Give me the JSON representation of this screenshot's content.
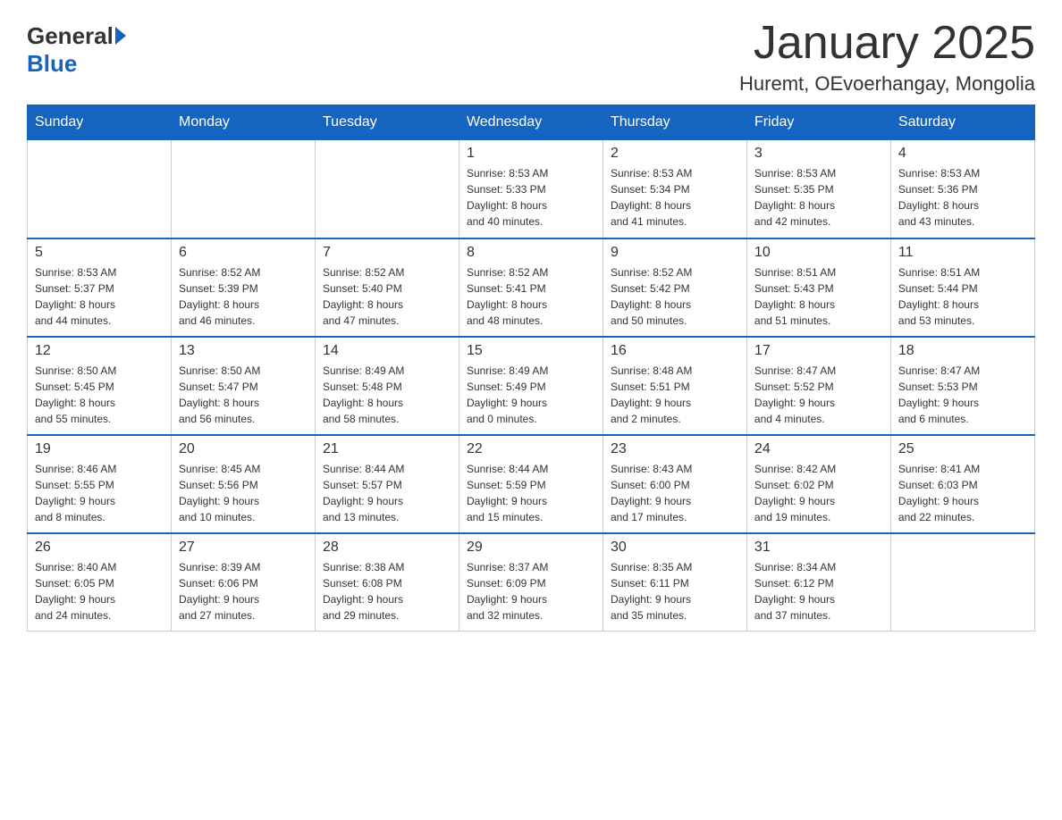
{
  "header": {
    "logo": {
      "general": "General",
      "blue": "Blue"
    },
    "title": "January 2025",
    "location": "Huremt, OEvoerhangay, Mongolia"
  },
  "days_of_week": [
    "Sunday",
    "Monday",
    "Tuesday",
    "Wednesday",
    "Thursday",
    "Friday",
    "Saturday"
  ],
  "weeks": [
    [
      {
        "day": "",
        "info": ""
      },
      {
        "day": "",
        "info": ""
      },
      {
        "day": "",
        "info": ""
      },
      {
        "day": "1",
        "info": "Sunrise: 8:53 AM\nSunset: 5:33 PM\nDaylight: 8 hours\nand 40 minutes."
      },
      {
        "day": "2",
        "info": "Sunrise: 8:53 AM\nSunset: 5:34 PM\nDaylight: 8 hours\nand 41 minutes."
      },
      {
        "day": "3",
        "info": "Sunrise: 8:53 AM\nSunset: 5:35 PM\nDaylight: 8 hours\nand 42 minutes."
      },
      {
        "day": "4",
        "info": "Sunrise: 8:53 AM\nSunset: 5:36 PM\nDaylight: 8 hours\nand 43 minutes."
      }
    ],
    [
      {
        "day": "5",
        "info": "Sunrise: 8:53 AM\nSunset: 5:37 PM\nDaylight: 8 hours\nand 44 minutes."
      },
      {
        "day": "6",
        "info": "Sunrise: 8:52 AM\nSunset: 5:39 PM\nDaylight: 8 hours\nand 46 minutes."
      },
      {
        "day": "7",
        "info": "Sunrise: 8:52 AM\nSunset: 5:40 PM\nDaylight: 8 hours\nand 47 minutes."
      },
      {
        "day": "8",
        "info": "Sunrise: 8:52 AM\nSunset: 5:41 PM\nDaylight: 8 hours\nand 48 minutes."
      },
      {
        "day": "9",
        "info": "Sunrise: 8:52 AM\nSunset: 5:42 PM\nDaylight: 8 hours\nand 50 minutes."
      },
      {
        "day": "10",
        "info": "Sunrise: 8:51 AM\nSunset: 5:43 PM\nDaylight: 8 hours\nand 51 minutes."
      },
      {
        "day": "11",
        "info": "Sunrise: 8:51 AM\nSunset: 5:44 PM\nDaylight: 8 hours\nand 53 minutes."
      }
    ],
    [
      {
        "day": "12",
        "info": "Sunrise: 8:50 AM\nSunset: 5:45 PM\nDaylight: 8 hours\nand 55 minutes."
      },
      {
        "day": "13",
        "info": "Sunrise: 8:50 AM\nSunset: 5:47 PM\nDaylight: 8 hours\nand 56 minutes."
      },
      {
        "day": "14",
        "info": "Sunrise: 8:49 AM\nSunset: 5:48 PM\nDaylight: 8 hours\nand 58 minutes."
      },
      {
        "day": "15",
        "info": "Sunrise: 8:49 AM\nSunset: 5:49 PM\nDaylight: 9 hours\nand 0 minutes."
      },
      {
        "day": "16",
        "info": "Sunrise: 8:48 AM\nSunset: 5:51 PM\nDaylight: 9 hours\nand 2 minutes."
      },
      {
        "day": "17",
        "info": "Sunrise: 8:47 AM\nSunset: 5:52 PM\nDaylight: 9 hours\nand 4 minutes."
      },
      {
        "day": "18",
        "info": "Sunrise: 8:47 AM\nSunset: 5:53 PM\nDaylight: 9 hours\nand 6 minutes."
      }
    ],
    [
      {
        "day": "19",
        "info": "Sunrise: 8:46 AM\nSunset: 5:55 PM\nDaylight: 9 hours\nand 8 minutes."
      },
      {
        "day": "20",
        "info": "Sunrise: 8:45 AM\nSunset: 5:56 PM\nDaylight: 9 hours\nand 10 minutes."
      },
      {
        "day": "21",
        "info": "Sunrise: 8:44 AM\nSunset: 5:57 PM\nDaylight: 9 hours\nand 13 minutes."
      },
      {
        "day": "22",
        "info": "Sunrise: 8:44 AM\nSunset: 5:59 PM\nDaylight: 9 hours\nand 15 minutes."
      },
      {
        "day": "23",
        "info": "Sunrise: 8:43 AM\nSunset: 6:00 PM\nDaylight: 9 hours\nand 17 minutes."
      },
      {
        "day": "24",
        "info": "Sunrise: 8:42 AM\nSunset: 6:02 PM\nDaylight: 9 hours\nand 19 minutes."
      },
      {
        "day": "25",
        "info": "Sunrise: 8:41 AM\nSunset: 6:03 PM\nDaylight: 9 hours\nand 22 minutes."
      }
    ],
    [
      {
        "day": "26",
        "info": "Sunrise: 8:40 AM\nSunset: 6:05 PM\nDaylight: 9 hours\nand 24 minutes."
      },
      {
        "day": "27",
        "info": "Sunrise: 8:39 AM\nSunset: 6:06 PM\nDaylight: 9 hours\nand 27 minutes."
      },
      {
        "day": "28",
        "info": "Sunrise: 8:38 AM\nSunset: 6:08 PM\nDaylight: 9 hours\nand 29 minutes."
      },
      {
        "day": "29",
        "info": "Sunrise: 8:37 AM\nSunset: 6:09 PM\nDaylight: 9 hours\nand 32 minutes."
      },
      {
        "day": "30",
        "info": "Sunrise: 8:35 AM\nSunset: 6:11 PM\nDaylight: 9 hours\nand 35 minutes."
      },
      {
        "day": "31",
        "info": "Sunrise: 8:34 AM\nSunset: 6:12 PM\nDaylight: 9 hours\nand 37 minutes."
      },
      {
        "day": "",
        "info": ""
      }
    ]
  ]
}
